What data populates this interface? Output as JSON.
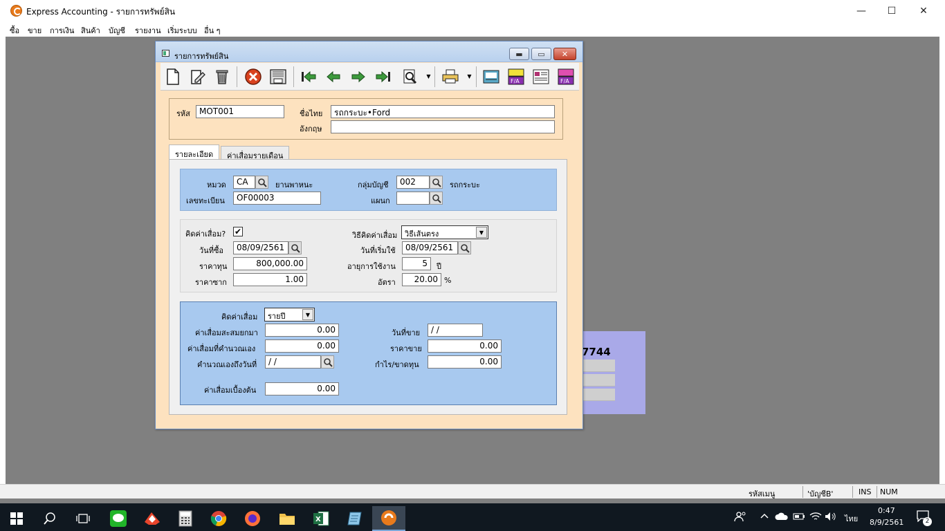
{
  "app": {
    "title": "Express Accounting - รายการทรัพย์สิน",
    "menu": [
      "ซื้อ",
      "ขาย",
      "การเงิน",
      "สินค้า",
      "บัญชี",
      "รายงาน",
      "เริ่มระบบ",
      "อื่น ๆ"
    ]
  },
  "window_controls": {
    "minimize": "—",
    "maximize": "☐",
    "close": "✕"
  },
  "background_panel": {
    "partial_text": "7744"
  },
  "dialog": {
    "title": "รายการทรัพย์สิน",
    "toolbar_icons": [
      "new-doc-icon",
      "edit-icon",
      "delete-icon",
      "cancel-icon",
      "save-icon",
      "first-record-icon",
      "previous-record-icon",
      "next-record-icon",
      "last-record-icon",
      "search-icon",
      "print-icon",
      "memo-icon",
      "bold-fa-icon",
      "form-icon",
      "misc-fa-icon"
    ],
    "header": {
      "code_label": "รหัส",
      "code_value": "MOT001",
      "thai_name_label": "ชื่อไทย",
      "thai_name_value": "รถกระบะ•Ford",
      "eng_name_label": "อังกฤษ",
      "eng_name_value": ""
    },
    "tabs": [
      {
        "label": "รายละเอียด",
        "active": true
      },
      {
        "label": "ค่าเสื่อมรายเดือน",
        "active": false
      }
    ],
    "detail": {
      "category_label": "หมวด",
      "category_code": "CA",
      "category_name": "ยานพาหนะ",
      "account_group_label": "กลุ่มบัญชี",
      "account_group_code": "002",
      "account_group_name": "รถกระบะ",
      "registration_label": "เลขทะเบียน",
      "registration_value": "OF00003",
      "department_label": "แผนก",
      "department_value": ""
    },
    "depreciation": {
      "calc_label": "คิดค่าเสื่อม?",
      "calc_checked": "✔",
      "method_label": "วิธีคิดค่าเสื่อม",
      "method_value": "วิธีเส้นตรง",
      "buy_date_label": "วันที่ซื้อ",
      "buy_date_value": "08/09/2561",
      "start_date_label": "วันที่เริ่มใช้",
      "start_date_value": "08/09/2561",
      "cost_label": "ราคาทุน",
      "cost_value": "800,000.00",
      "life_label": "อายุการใช้งาน",
      "life_value": "5",
      "life_unit": "ปี",
      "salvage_label": "ราคาซาก",
      "salvage_value": "1.00",
      "rate_label": "อัตรา",
      "rate_value": "20.00",
      "rate_unit": "%"
    },
    "summary": {
      "period_label": "คิดค่าเสื่อม",
      "period_value": "รายปี",
      "accumulated_label": "ค่าเสื่อมสะสมยกมา",
      "accumulated_value": "0.00",
      "self_calc_label": "ค่าเสื่อมที่คำนวณเอง",
      "self_calc_value": "0.00",
      "calc_to_date_label": "คำนวณเองถึงวันที่",
      "calc_to_date_value": " / /",
      "initial_label": "ค่าเสื่อมเบื้องต้น",
      "initial_value": "0.00",
      "sale_date_label": "วันที่ขาย",
      "sale_date_value": "  /  /",
      "sale_price_label": "ราคาขาย",
      "sale_price_value": "0.00",
      "profit_loss_label": "กำไร/ขาดทุน",
      "profit_loss_value": "0.00"
    }
  },
  "statusbar": {
    "menu_code": "รหัสเมนู",
    "menu_value": "'บัญชีB'",
    "ins": "INS",
    "num": "NUM"
  },
  "taskbar": {
    "apps": [
      "start-icon",
      "search-icon",
      "task-view-icon",
      "line-icon",
      "anydesk-icon",
      "calculator-icon",
      "chrome-icon",
      "firefox-icon",
      "file-explorer-icon",
      "excel-icon",
      "notepad-icon",
      "express-icon"
    ],
    "lang": "ไทย",
    "time": "0:47",
    "date": "8/9/2561",
    "notifications": "2"
  },
  "colors": {
    "dialog_bg": "#fde2bf",
    "panel_blue": "#a8c9ef",
    "desktop_grey": "#808080",
    "taskbar": "#101820"
  }
}
